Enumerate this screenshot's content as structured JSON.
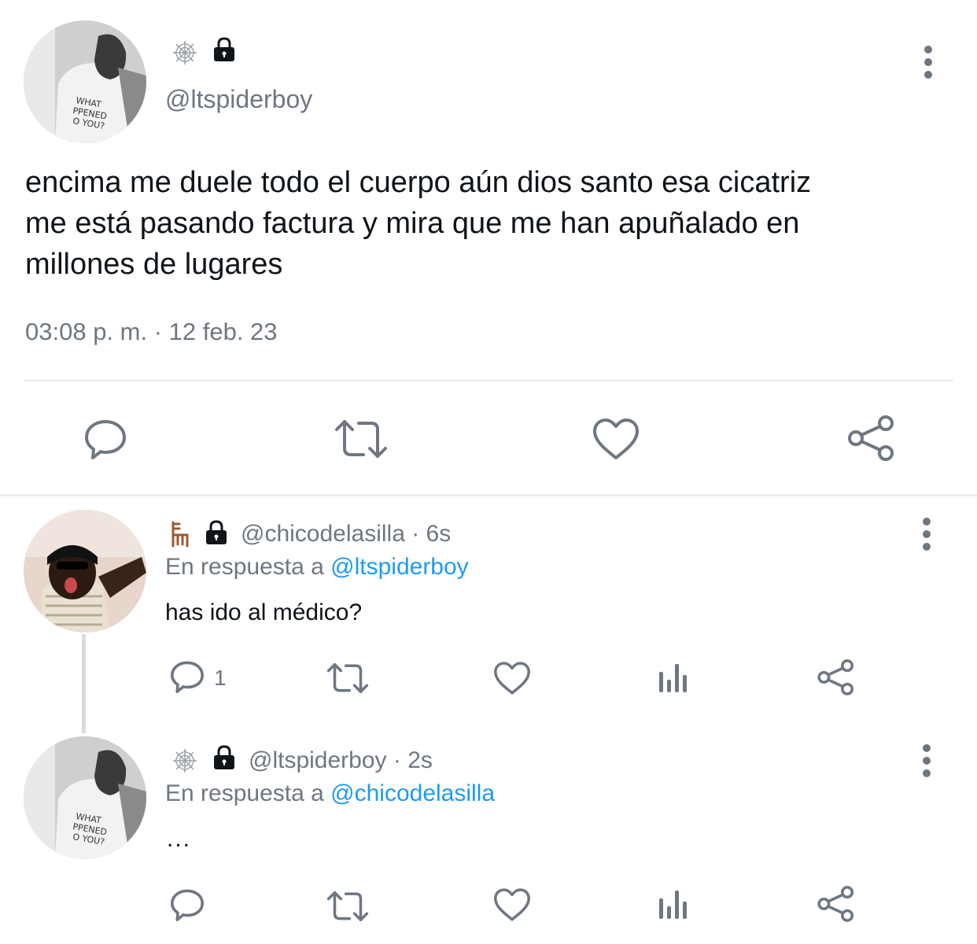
{
  "main_tweet": {
    "handle": "@ltspiderboy",
    "text_line1": "encima me duele todo el cuerpo aún dios santo esa cicatriz",
    "text_line2": "me está pasando factura y mira que me han apuñalado en",
    "text_line3": "millones de lugares",
    "timestamp": "03:08 p. m. · 12 feb. 23",
    "name_icons": [
      "spider-web-icon",
      "lock-icon"
    ],
    "actions": [
      "reply-icon",
      "retweet-icon",
      "like-icon",
      "share-icon"
    ]
  },
  "replies": [
    {
      "handle_time": "@chicodelasilla · 6s",
      "reply_prefix": "En respuesta a",
      "reply_to": "@ltspiderboy",
      "text": "has ido al médico?",
      "reply_count": "1",
      "name_icons": [
        "chair-icon",
        "lock-icon"
      ]
    },
    {
      "handle_time": "@ltspiderboy · 2s",
      "reply_prefix": "En respuesta a",
      "reply_to": "@chicodelasilla",
      "text": "...",
      "reply_count": "",
      "name_icons": [
        "spider-web-icon",
        "lock-icon"
      ]
    }
  ],
  "colors": {
    "text": "#0f1419",
    "secondary": "#6e7781",
    "link": "#1d9bf0",
    "divider": "#e6e8ea"
  }
}
